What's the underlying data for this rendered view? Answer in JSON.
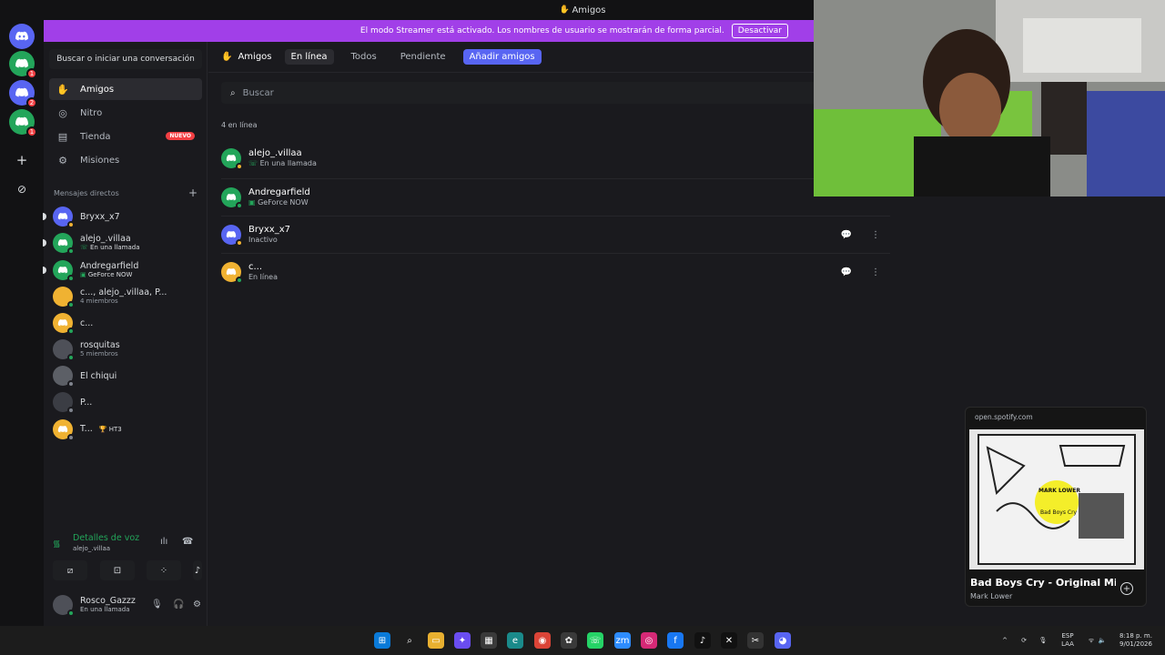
{
  "window": {
    "title": "Amigos"
  },
  "banner": {
    "text": "El modo Streamer está activado. Los nombres de usuario se mostrarán de forma parcial.",
    "button": "Desactivar"
  },
  "servers": [
    {
      "icon": "discord-home-icon",
      "badge": ""
    },
    {
      "icon": "server-icon",
      "badge": "1"
    },
    {
      "icon": "server-icon",
      "badge": "2"
    },
    {
      "icon": "server-icon",
      "badge": "1"
    }
  ],
  "sidebar": {
    "search_label": "Buscar o iniciar una conversación",
    "nav": [
      {
        "label": "Amigos",
        "icon": "friends-icon"
      },
      {
        "label": "Nitro",
        "icon": "nitro-icon"
      },
      {
        "label": "Tienda",
        "icon": "shop-icon",
        "badge": "NUEVO"
      },
      {
        "label": "Misiones",
        "icon": "quests-icon"
      }
    ],
    "dm_header": "Mensajes directos",
    "dms": [
      {
        "name": "Bryxx_x7",
        "sub": ""
      },
      {
        "name": "alejo_.villaa",
        "sub": "En una llamada"
      },
      {
        "name": "Andregarfield",
        "sub": "GeForce NOW"
      },
      {
        "name": "c..., alejo_.villaa, P...",
        "sub": "4 miembros"
      },
      {
        "name": "c...",
        "sub": ""
      },
      {
        "name": "rosquitas",
        "sub": "5 miembros"
      },
      {
        "name": "El chiqui",
        "sub": ""
      },
      {
        "name": "P...",
        "sub": ""
      },
      {
        "name": "T...",
        "sub": "",
        "tag": "🏆 HT3"
      }
    ]
  },
  "voice": {
    "title": "Detalles de voz",
    "channel": "alejo_.villaa"
  },
  "user": {
    "name": "Rosco_Gazzz",
    "status": "En una llamada"
  },
  "main": {
    "friends_label": "Amigos",
    "tabs": [
      "En línea",
      "Todos",
      "Pendiente"
    ],
    "add_friends": "Añadir amigos",
    "search_placeholder": "Buscar",
    "online_count": "4 en línea",
    "friends": [
      {
        "name": "alejo_.villaa",
        "status": "En una llamada",
        "color": "#23a55a"
      },
      {
        "name": "Andregarfield",
        "status": "GeForce NOW",
        "color": "#23a55a"
      },
      {
        "name": "Bryxx_x7",
        "status": "Inactivo",
        "color": "#5865f2"
      },
      {
        "name": "c...",
        "status": "En línea",
        "color": "#f0b232"
      }
    ]
  },
  "spotify": {
    "url": "open.spotify.com",
    "title": "Bad Boys Cry - Original Mi",
    "artist": "Mark Lower",
    "art_text": "MARK LOWER",
    "art_sub": "Bad Boys Cry"
  },
  "taskbar": {
    "lang": "ESP",
    "lang_sub": "LAA",
    "time": "8:18 p. m.",
    "date": "9/01/2026"
  }
}
